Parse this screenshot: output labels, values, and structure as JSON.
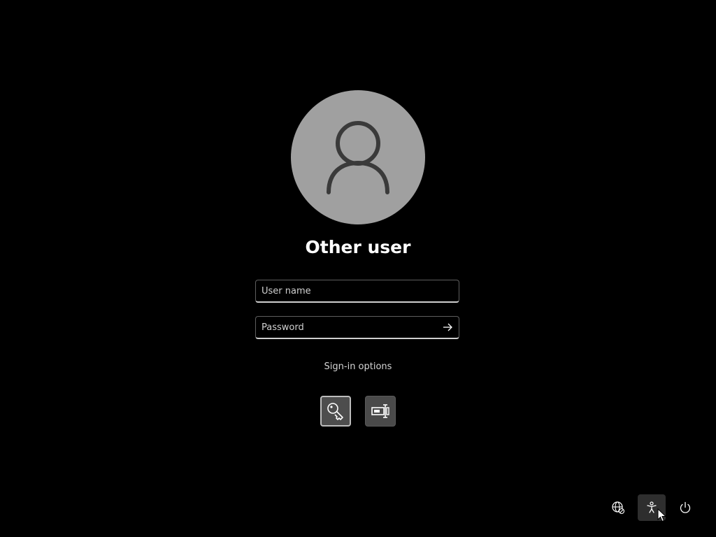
{
  "account": {
    "display_name": "Other user",
    "avatar_icon": "person-icon"
  },
  "fields": {
    "username_placeholder": "User name",
    "username_value": "",
    "password_placeholder": "Password",
    "password_value": "",
    "submit_icon": "arrow-right-icon"
  },
  "signin": {
    "options_label": "Sign-in options",
    "options": [
      {
        "icon": "key-icon",
        "selected": true
      },
      {
        "icon": "password-field-icon",
        "selected": false
      }
    ]
  },
  "tray": {
    "items": [
      {
        "icon": "network-icon"
      },
      {
        "icon": "accessibility-icon",
        "hovered": true
      },
      {
        "icon": "power-icon"
      }
    ]
  },
  "colors": {
    "background": "#000000",
    "avatar_circle": "#a0a0a0",
    "avatar_glyph": "#3a3a3a",
    "field_underline": "#cfcfcf",
    "option_button": "#4a4a4a"
  }
}
